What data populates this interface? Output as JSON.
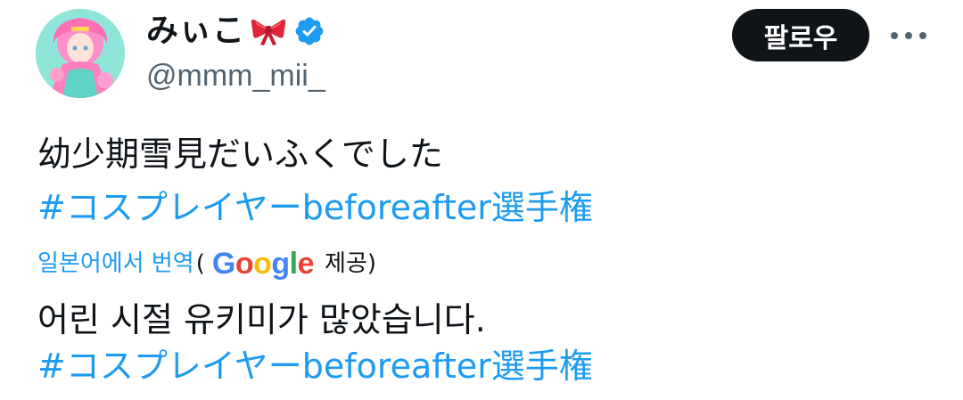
{
  "user": {
    "display_name": "みぃこ",
    "handle": "@mmm_mii_",
    "name_emoji_icon": "ribbon-bow-icon",
    "verified_icon": "verified-badge-icon"
  },
  "actions": {
    "follow_label": "팔로우",
    "more_icon": "more-dots-icon"
  },
  "tweet": {
    "text": "幼少期雪見だいふくでした",
    "hashtag": "#コスプレイヤーbeforeafter選手権"
  },
  "translation": {
    "link_label": "일본어에서 번역",
    "open_paren": "(",
    "provider_logo": "Google",
    "provided_label": "제공)",
    "text": "어린 시절 유키미가 많았습니다.",
    "hashtag": "#コスプレイヤーbeforeafter選手権"
  },
  "colors": {
    "link": "#1d9bf0",
    "text": "#0f1419",
    "secondary": "#536471",
    "follow_bg": "#0f1419",
    "verified": "#1d9bf0"
  }
}
